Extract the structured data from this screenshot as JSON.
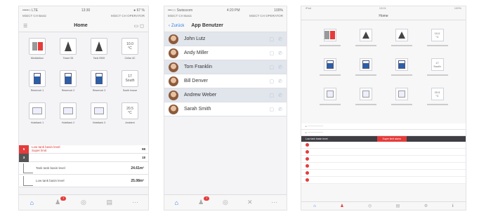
{
  "phone1": {
    "status": {
      "carrier": "•••••○ LTE",
      "time": "13:30",
      "battery": "● 67 %"
    },
    "subheader": {
      "left": "MiniCT CH Basic",
      "right": "MiniCT CH OPERATOR"
    },
    "title": "Home",
    "tiles": [
      {
        "caption": "Medizinbox",
        "kind": "red"
      },
      {
        "caption": "Tower 05",
        "kind": "tower"
      },
      {
        "caption": "Tank 0900",
        "kind": "tower"
      },
      {
        "caption": "Cellar 4C",
        "kind": "temp",
        "value": "10.0\n°C"
      },
      {
        "caption": "Reservoir 1",
        "kind": "tank"
      },
      {
        "caption": "Reservoir 2",
        "kind": "tank"
      },
      {
        "caption": "Reservoir 3",
        "kind": "tank"
      },
      {
        "caption": "South house",
        "kind": "temp",
        "value": "17\nSouth"
      },
      {
        "caption": "Hoteltank 1",
        "kind": "gauge"
      },
      {
        "caption": "Hoteltank 2",
        "kind": "gauge"
      },
      {
        "caption": "Hoteltank 3",
        "kind": "gauge"
      },
      {
        "caption": "Ambient",
        "kind": "temp",
        "value": "20.5\n°C"
      }
    ],
    "alarms": [
      {
        "badge": "5",
        "text": "Low tank basin level\nSuper limit",
        "value": "98"
      },
      {
        "badge": "3",
        "text": "",
        "value": "18"
      }
    ],
    "levels": [
      {
        "text": "Tank tank basin level",
        "value": "24.61m³"
      },
      {
        "text": "Low tank basin level",
        "value": "25.08m³"
      }
    ],
    "tabbar": {
      "badge": "7"
    }
  },
  "phone2": {
    "status": {
      "carrier": "•••○○ Swisscom",
      "time": "4:20 PM",
      "battery": "100%"
    },
    "subheader": {
      "left": "MiniCT CH Basic",
      "right": "MiniCT CH OPERATOR"
    },
    "back_label": "Zurück",
    "title": "App Benutzer",
    "users": [
      "John Lutz",
      "Andy Miller",
      "Tom Franklin",
      "Bill Denver",
      "Andrew Weber",
      "Sarah Smith"
    ],
    "tabbar": {
      "badge": "7"
    }
  },
  "tablet": {
    "status": {
      "left": "iPad",
      "time": "13:01",
      "right": "100%"
    },
    "title": "Home",
    "tiles": [
      "",
      "",
      "",
      "10.0\n°C",
      "",
      "",
      "",
      "17\nSouth",
      "",
      "",
      "",
      "20.5\n°C"
    ],
    "bar_left": "Low tank basin level",
    "bar_right": "Super limit alarm"
  },
  "colors": {
    "accent": "#2f7de1",
    "alarm": "#e53b3b"
  }
}
